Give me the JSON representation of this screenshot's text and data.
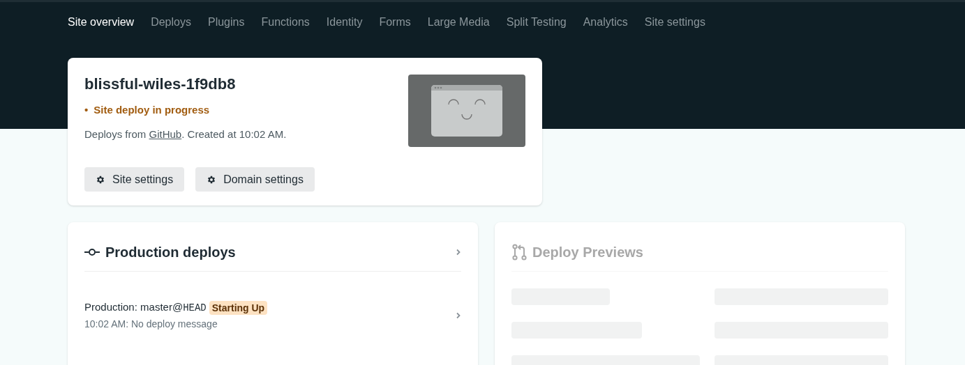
{
  "nav": {
    "tabs": [
      {
        "label": "Site overview",
        "selected": true
      },
      {
        "label": "Deploys",
        "selected": false
      },
      {
        "label": "Plugins",
        "selected": false
      },
      {
        "label": "Functions",
        "selected": false
      },
      {
        "label": "Identity",
        "selected": false
      },
      {
        "label": "Forms",
        "selected": false
      },
      {
        "label": "Large Media",
        "selected": false
      },
      {
        "label": "Split Testing",
        "selected": false
      },
      {
        "label": "Analytics",
        "selected": false
      },
      {
        "label": "Site settings",
        "selected": false
      }
    ]
  },
  "site_card": {
    "name": "blissful-wiles-1f9db8",
    "bullet": "•",
    "status": "Site deploy in progress",
    "source_prefix": "Deploys from ",
    "source_link": "GitHub",
    "source_suffix": ". Created at 10:02 AM.",
    "buttons": [
      "Site settings",
      "Domain settings"
    ]
  },
  "production": {
    "title": "Production deploys",
    "deploys": [
      {
        "label": "Production: master@",
        "ref": "HEAD",
        "badge": "Starting Up",
        "detail": "10:02 AM: No deploy message"
      }
    ]
  },
  "previews": {
    "title": "Deploy Previews",
    "loading": true
  }
}
